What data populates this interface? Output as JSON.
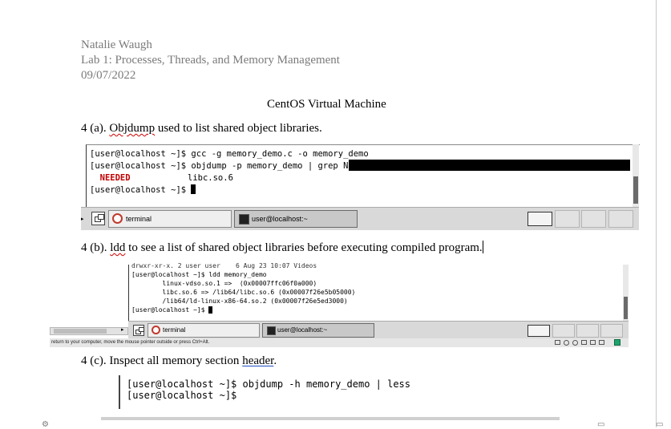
{
  "header": {
    "author": "Natalie Waugh",
    "lab_title": "Lab 1:  Processes, Threads, and Memory Management",
    "date": "09/07/2022"
  },
  "section_heading": "CentOS Virtual Machine",
  "items": [
    {
      "prefix": "4 (a). ",
      "keyword": "Objdump",
      "rest": " used to list shared object libraries."
    },
    {
      "prefix": "4 (b). ",
      "keyword": "ldd",
      "rest": " to see a list of shared object libraries before executing compiled program."
    },
    {
      "prefix": "4 (c). Inspect all memory section ",
      "keyword": "header",
      "rest": "."
    }
  ],
  "terminal1": {
    "lines": [
      "[user@localhost ~]$ gcc -g memory_demo.c -o memory_demo",
      "[user@localhost ~]$ objdump -p memory_demo | grep NEEDED",
      "  NEEDED",
      "[user@localhost ~]$ "
    ],
    "needed_value": "libc.so.6"
  },
  "taskbar1": {
    "buttons": [
      {
        "label": "terminal"
      },
      {
        "label": "user@localhost:~"
      }
    ]
  },
  "terminal2": {
    "lines": [
      "drwxr-xr-x. 2 user user    6 Aug 23 10:07 Videos",
      "[user@localhost ~]$ ldd memory_demo",
      "        linux-vdso.so.1 =>  (0x00007ffc06f0a000)",
      "        libc.so.6 => /lib64/libc.so.6 (0x00007f26e5b05000)",
      "        /lib64/ld-linux-x86-64.so.2 (0x00007f26e5ed3000)",
      "[user@localhost ~]$ "
    ]
  },
  "taskbar2": {
    "buttons": [
      {
        "label": "terminal"
      },
      {
        "label": "user@localhost:~"
      }
    ]
  },
  "statusbar": {
    "text": "return to your computer, move the mouse pointer outside or press Ctrl+Alt."
  },
  "terminal3": {
    "lines": [
      "[user@localhost ~]$ objdump -h memory_demo | less",
      "[user@localhost ~]$ "
    ]
  },
  "icons": {
    "terminal_app": "terminal-icon",
    "console_app": "console-icon",
    "show_desktop": "show-desktop-icon"
  },
  "colors": {
    "heading_gray": "#7a7a7a",
    "needed_red": "#c00000",
    "spell_underline": "#d00000",
    "grammar_underline": "#1f4fbf"
  }
}
